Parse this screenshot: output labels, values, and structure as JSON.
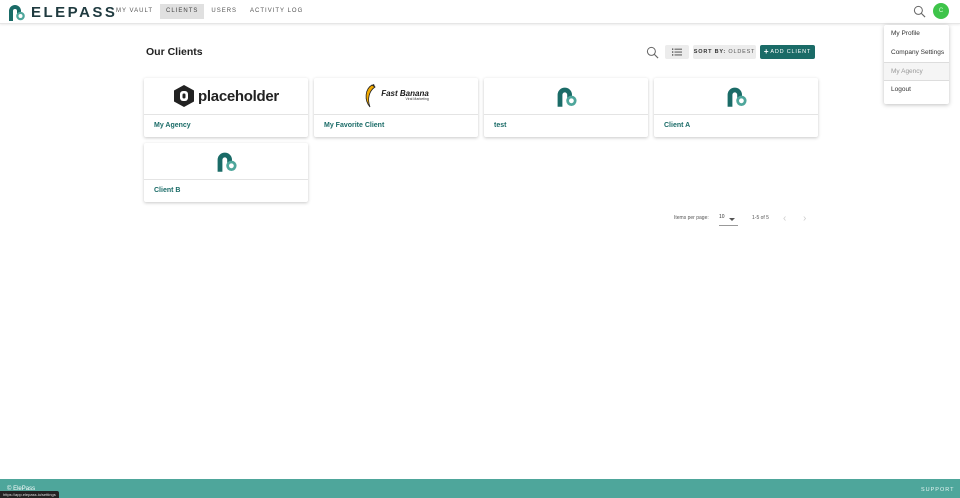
{
  "brand": {
    "name": "ELEPASS",
    "color": "#1a6b67",
    "accent": "#4ea69b"
  },
  "nav": {
    "items": [
      {
        "label": "MY VAULT",
        "active": false
      },
      {
        "label": "CLIENTS",
        "active": true
      },
      {
        "label": "USERS",
        "active": false
      },
      {
        "label": "ACTIVITY LOG",
        "active": false
      }
    ]
  },
  "header": {
    "search_icon": "search-icon",
    "avatar_initials": "C",
    "avatar_color": "#3ec44a"
  },
  "user_menu": {
    "items": [
      {
        "label": "My Profile"
      },
      {
        "label": "Company Settings"
      },
      {
        "label": "My Agency",
        "muted": true
      },
      {
        "label": "Logout"
      }
    ]
  },
  "main": {
    "title": "Our Clients",
    "toolbar": {
      "search_icon": "search-icon",
      "view_icon": "list-view-icon",
      "sort_prefix": "SORT BY:",
      "sort_value": "OLDEST",
      "add_label": "ADD CLIENT"
    },
    "clients": [
      {
        "name": "My Agency",
        "logo": "placeholder-logo",
        "logo_text": "placeholder"
      },
      {
        "name": "My Favorite Client",
        "logo": "fast-banana-logo",
        "logo_text": "Fast Banana",
        "logo_subtext": "Viral Marketing"
      },
      {
        "name": "test",
        "logo": "elepass-default-logo"
      },
      {
        "name": "Client A",
        "logo": "elepass-default-logo"
      },
      {
        "name": "Client B",
        "logo": "elepass-default-logo"
      }
    ]
  },
  "pagination": {
    "items_per_page_label": "Items per page:",
    "items_per_page": "10",
    "range": "1-5 of 5"
  },
  "footer": {
    "copyright": "© ElePass",
    "support": "SUPPORT"
  },
  "status_bar": {
    "url": "https://app.elepass.io/settings"
  }
}
